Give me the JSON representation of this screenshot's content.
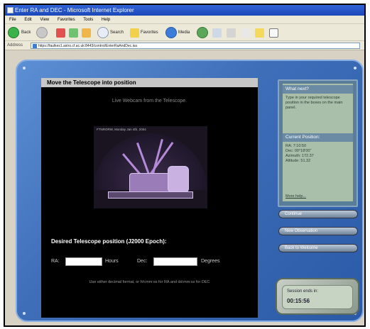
{
  "browser": {
    "window_title": "Enter RA and DEC - Microsoft Internet Explorer",
    "menu": [
      "File",
      "Edit",
      "View",
      "Favorites",
      "Tools",
      "Help"
    ],
    "toolbar": {
      "back": "Back",
      "search": "Search",
      "favorites": "Favorites",
      "media": "Media"
    },
    "address_label": "Address",
    "address_value": "https://faulkes1.astro.cf.ac.uk:8443/control/EnterRaAndDec.isa"
  },
  "main_panel": {
    "header": "Move the Telescope into position",
    "webcam_title": "Live Webcam from the Telescope.",
    "webcam_timestamp": "FTNRORW, Monday Jan 4th, 2004",
    "desired_title": "Desired Telescope position (J2000 Epoch):",
    "ra_label": "RA:",
    "ra_value": "",
    "ra_unit": "Hours",
    "dec_label": "Dec:",
    "dec_value": "",
    "dec_unit": "Degrees",
    "hint": "Use either decimal format, or hh:mm:ss for RA and dd:mm:ss for DEC"
  },
  "side_panel": {
    "what_next_title": "What next?",
    "what_next_text": "Type in your required telescope position in the boxes on the main panel.",
    "current_title": "Current Position:",
    "current_lines": [
      "RA: 7:10:50",
      "Dec: 00°18'00\"",
      "Azimuth: 172.37",
      "Altitude: 51.32"
    ],
    "more_link": "More help..."
  },
  "buttons": {
    "continue": "Continue",
    "new_observation": "New Observation",
    "back_to_welcome": "Back to Welcome"
  },
  "session": {
    "label": "Session ends in:",
    "time": "00:15:56"
  },
  "colors": {
    "app_blue": "#3f6fb9",
    "panel_black": "#000000",
    "side_green": "#a9bfaa"
  }
}
